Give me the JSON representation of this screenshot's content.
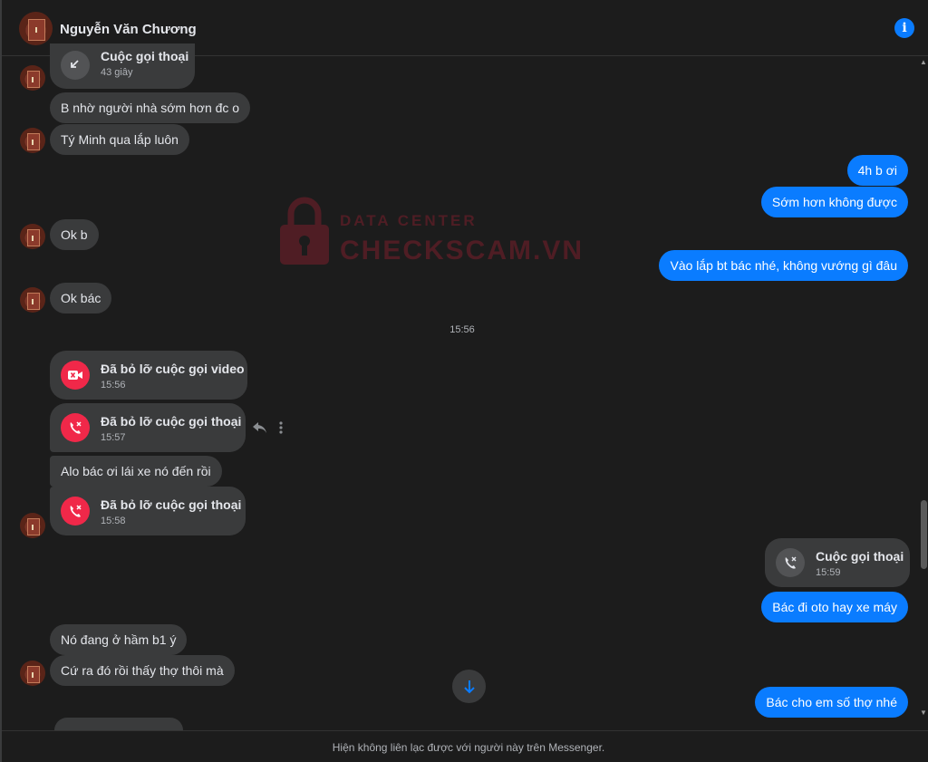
{
  "header": {
    "contact_name": "Nguyễn Văn Chương",
    "info_icon": "info-icon",
    "info_glyph": "i"
  },
  "watermark": {
    "line1": "DATA CENTER",
    "line2": "CHECKSCAM.VN"
  },
  "messages": {
    "call_top_title": "Cuộc gọi thoại",
    "call_top_duration": "43 giây",
    "m1": "B nhờ người nhà sớm hơn đc o",
    "m2": "Tý Minh qua lắp luôn",
    "m3": "4h b ơi",
    "m4": "Sớm hơn không được",
    "m5": "Ok b",
    "m6": "Vào lắp bt bác nhé, không vướng gì đâu",
    "m7": "Ok bác",
    "timestamp": "15:56",
    "missed_video_title": "Đã bỏ lỡ cuộc gọi video",
    "missed_video_time": "15:56",
    "missed_voice1_title": "Đã bỏ lỡ cuộc gọi thoại",
    "missed_voice1_time": "15:57",
    "m8": "Alo bác ơi lái xe nó đến rồi",
    "missed_voice2_title": "Đã bỏ lỡ cuộc gọi thoại",
    "missed_voice2_time": "15:58",
    "out_call_title": "Cuộc gọi thoại",
    "out_call_time": "15:59",
    "m9": "Bác đi oto hay xe máy",
    "m10": "Nó đang ở hầm b1 ý",
    "m11": "Cứ ra đó rồi thấy thợ thôi mà",
    "m12": "Bác cho em số thợ nhé"
  },
  "footer": {
    "note": "Hiện không liên lạc được với người này trên Messenger."
  },
  "colors": {
    "incoming_bubble": "#3a3b3c",
    "outgoing_bubble": "#0a7cff",
    "missed_call_red": "#f02849",
    "background": "#1c1c1c"
  }
}
